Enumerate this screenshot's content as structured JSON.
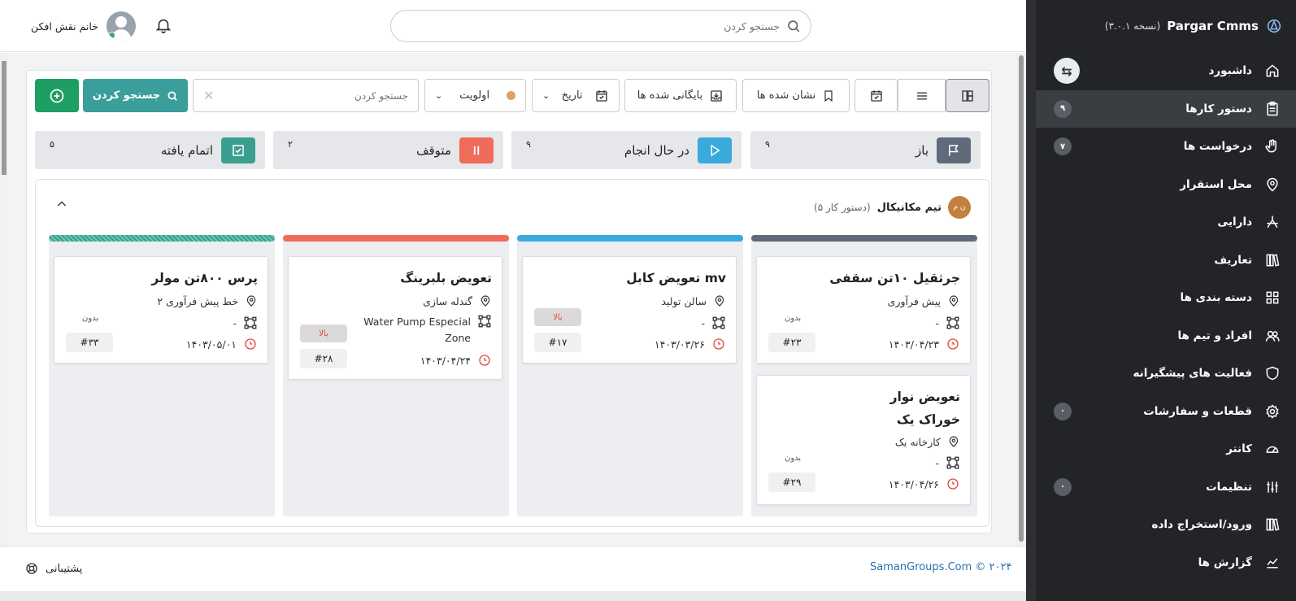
{
  "brand": {
    "name": "Pargar Cmms",
    "version": "(نسخه ۳.۰.۱)"
  },
  "sidebar": {
    "items": [
      {
        "label": "داشبورد",
        "icon": "home-icon",
        "badge": ""
      },
      {
        "label": "دستور کارها",
        "icon": "clipboard-icon",
        "badge": "۹"
      },
      {
        "label": "درخواست ها",
        "icon": "hand-icon",
        "badge": "۷"
      },
      {
        "label": "محل استقرار",
        "icon": "location-icon",
        "badge": ""
      },
      {
        "label": "دارایی",
        "icon": "asset-icon",
        "badge": ""
      },
      {
        "label": "تعاریف",
        "icon": "books-icon",
        "badge": ""
      },
      {
        "label": "دسته بندی ها",
        "icon": "grid-icon",
        "badge": ""
      },
      {
        "label": "افراد و تیم ها",
        "icon": "people-icon",
        "badge": ""
      },
      {
        "label": "فعالیت های پیشگیرانه",
        "icon": "shield-icon",
        "badge": ""
      },
      {
        "label": "قطعات و سفارشات",
        "icon": "gear-icon",
        "badge": "۰"
      },
      {
        "label": "کانتر",
        "icon": "gauge-icon",
        "badge": ""
      },
      {
        "label": "تنظیمات",
        "icon": "sliders-icon",
        "badge": "۰"
      },
      {
        "label": "ورود/استخراج داده",
        "icon": "books-icon",
        "badge": ""
      },
      {
        "label": "گزارش ها",
        "icon": "chart-icon",
        "badge": ""
      }
    ]
  },
  "topbar": {
    "search_placeholder": "جستجو کردن",
    "user_name": "خانم نقش افکن"
  },
  "toolbar": {
    "search_button": "جستجو کردن",
    "search_placeholder": "جستجو کردن",
    "priority": "اولویت",
    "date": "تاریخ",
    "archived": "بایگانی شده ها",
    "bookmarked": "نشان شده ها"
  },
  "statuses": [
    {
      "label": "باز",
      "count": "۹",
      "color": "#5f6b7a"
    },
    {
      "label": "در حال انجام",
      "count": "۹",
      "color": "#3aa9db"
    },
    {
      "label": "متوقف",
      "count": "۲",
      "color": "#ef6b5a"
    },
    {
      "label": "اتمام یافته",
      "count": "۵",
      "color": "#3a9f8e"
    }
  ],
  "team": {
    "name": "تیم مکانیکال",
    "count_text": "(۵ دستور کار)",
    "avatar": "ن م"
  },
  "columns": [
    {
      "cards": [
        {
          "title": "جرثقیل ۱۰تن سقفی",
          "location": "پیش فرآوری",
          "asset": "-",
          "date": "۱۴۰۳/۰۴/۲۳",
          "id": "#۲۳",
          "priority": "بدون"
        },
        {
          "title": "تعویض نوار خوراک یک",
          "location": "کارخانه یک",
          "asset": "-",
          "date": "۱۴۰۳/۰۴/۲۶",
          "id": "#۲۹",
          "priority": "بدون"
        }
      ]
    },
    {
      "cards": [
        {
          "title": "تعویض کابل mv",
          "location": "سالن تولید",
          "asset": "-",
          "date": "۱۴۰۳/۰۳/۲۶",
          "id": "#۱۷",
          "priority": "بالا"
        }
      ]
    },
    {
      "cards": [
        {
          "title": "تعویض بلبرینگ",
          "location": "گندله سازی",
          "asset": "Water Pump Especial Zone",
          "date": "۱۴۰۳/۰۴/۲۴",
          "id": "#۲۸",
          "priority": "بالا"
        }
      ]
    },
    {
      "cards": [
        {
          "title": "پرس ۸۰۰تن مولر",
          "location": "خط پیش فرآوری ۲",
          "asset": "-",
          "date": "۱۴۰۳/۰۵/۰۱",
          "id": "#۳۳",
          "priority": "بدون"
        }
      ]
    }
  ],
  "footer": {
    "copyright": "SamanGroups.Com © ۲۰۲۴",
    "support": "پشتیبانی"
  }
}
